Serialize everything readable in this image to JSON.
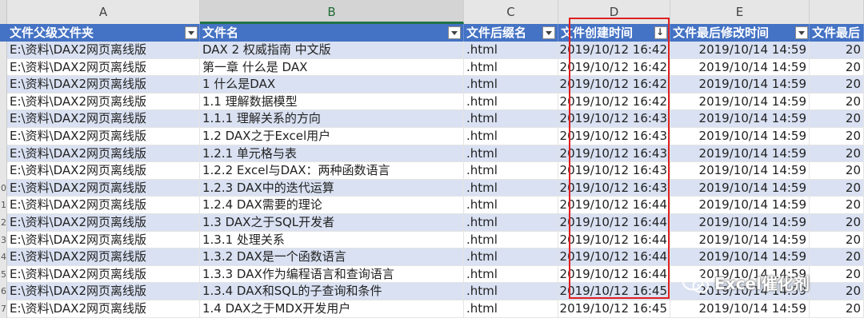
{
  "columns": [
    "A",
    "B",
    "C",
    "D",
    "E"
  ],
  "table_headers": [
    "文件父级文件夹",
    "文件名",
    "文件后缀名",
    "文件创建时间",
    "文件最后修改时间",
    "文件最后"
  ],
  "rows": [
    {
      "folder": "E:\\资料\\DAX2网页离线版",
      "name": "DAX 2 权威指南 中文版",
      "ext": ".html",
      "created": "2019/10/12 16:42",
      "modified": "2019/10/14 14:59",
      "extra": "20"
    },
    {
      "folder": "E:\\资料\\DAX2网页离线版",
      "name": "第一章 什么是 DAX",
      "ext": ".html",
      "created": "2019/10/12 16:42",
      "modified": "2019/10/14 14:59",
      "extra": "20"
    },
    {
      "folder": "E:\\资料\\DAX2网页离线版",
      "name": "1 什么是DAX",
      "ext": ".html",
      "created": "2019/10/12 16:42",
      "modified": "2019/10/14 14:59",
      "extra": "20"
    },
    {
      "folder": "E:\\资料\\DAX2网页离线版",
      "name": "1.1 理解数据模型",
      "ext": ".html",
      "created": "2019/10/12 16:42",
      "modified": "2019/10/14 14:59",
      "extra": "20"
    },
    {
      "folder": "E:\\资料\\DAX2网页离线版",
      "name": "1.1.1 理解关系的方向",
      "ext": ".html",
      "created": "2019/10/12 16:43",
      "modified": "2019/10/14 14:59",
      "extra": "20"
    },
    {
      "folder": "E:\\资料\\DAX2网页离线版",
      "name": "1.2 DAX之于Excel用户",
      "ext": ".html",
      "created": "2019/10/12 16:43",
      "modified": "2019/10/14 14:59",
      "extra": "20"
    },
    {
      "folder": "E:\\资料\\DAX2网页离线版",
      "name": "1.2.1 单元格与表",
      "ext": ".html",
      "created": "2019/10/12 16:43",
      "modified": "2019/10/14 14:59",
      "extra": "20"
    },
    {
      "folder": "E:\\资料\\DAX2网页离线版",
      "name": "1.2.2 Excel与DAX：两种函数语言",
      "ext": ".html",
      "created": "2019/10/12 16:43",
      "modified": "2019/10/14 14:59",
      "extra": "20"
    },
    {
      "folder": "E:\\资料\\DAX2网页离线版",
      "name": "1.2.3 DAX中的迭代运算",
      "ext": ".html",
      "created": "2019/10/12 16:43",
      "modified": "2019/10/14 14:59",
      "extra": "20"
    },
    {
      "folder": "E:\\资料\\DAX2网页离线版",
      "name": "1.2.4 DAX需要的理论",
      "ext": ".html",
      "created": "2019/10/12 16:44",
      "modified": "2019/10/14 14:59",
      "extra": "20"
    },
    {
      "folder": "E:\\资料\\DAX2网页离线版",
      "name": "1.3 DAX之于SQL开发者",
      "ext": ".html",
      "created": "2019/10/12 16:44",
      "modified": "2019/10/14 14:59",
      "extra": "20"
    },
    {
      "folder": "E:\\资料\\DAX2网页离线版",
      "name": "1.3.1 处理关系",
      "ext": ".html",
      "created": "2019/10/12 16:44",
      "modified": "2019/10/14 14:59",
      "extra": "20"
    },
    {
      "folder": "E:\\资料\\DAX2网页离线版",
      "name": "1.3.2 DAX是一个函数语言",
      "ext": ".html",
      "created": "2019/10/12 16:44",
      "modified": "2019/10/14 14:59",
      "extra": "20"
    },
    {
      "folder": "E:\\资料\\DAX2网页离线版",
      "name": "1.3.3 DAX作为编程语言和查询语言",
      "ext": ".html",
      "created": "2019/10/12 16:44",
      "modified": "2019/10/14 14:59",
      "extra": "20"
    },
    {
      "folder": "E:\\资料\\DAX2网页离线版",
      "name": "1.3.4 DAX和SQL的子查询和条件",
      "ext": ".html",
      "created": "2019/10/12 16:45",
      "modified": "2019/10/14 14:59",
      "extra": "20"
    },
    {
      "folder": "E:\\资料\\DAX2网页离线版",
      "name": "1.4 DAX之于MDX开发用户",
      "ext": ".html",
      "created": "2019/10/12 16:45",
      "modified": "2019/10/14 14:59",
      "extra": "20"
    }
  ],
  "row_numbers": [
    "",
    "",
    "",
    "",
    "",
    "",
    "",
    "",
    "0",
    "1",
    "2",
    "3",
    "4",
    "5",
    "6",
    "7"
  ],
  "watermark": "Excel催化剂",
  "colors": {
    "header_blue": "#4472c4",
    "band": "#d9e1f2",
    "highlight_red": "#e02020"
  }
}
